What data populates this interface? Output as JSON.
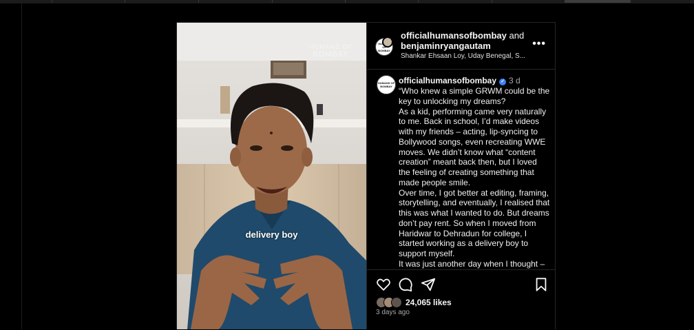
{
  "header": {
    "account_primary": "officialhumansofbombay",
    "joiner": "and",
    "account_collab": "benjaminryangautam",
    "audio_subtitle": "Shankar Ehsaan Loy, Uday Benegal, S...",
    "more_glyph": "•••"
  },
  "media": {
    "overlay_brand_line1": "HUMANS OF",
    "overlay_brand_line2": "BOMBAY",
    "subtitle_text": "delivery boy"
  },
  "caption": {
    "username": "officialhumansofbombay",
    "verified_glyph": "✓",
    "time_ago": "3 d",
    "paragraphs": [
      "“Who knew a simple GRWM could be the key to unlocking my dreams?",
      "As a kid, performing came very naturally to me. Back in school, I’d make videos with my friends – acting, lip-syncing to Bollywood songs, even recreating WWE moves. We didn’t know what “content creation” meant back then, but I loved the feeling of creating something that made people smile.",
      "Over time, I got better at editing, framing, storytelling, and eventually, I realised that this was what I wanted to do. But dreams don’t pay rent. So when I moved from Haridwar to Dehradun for college, I started working as a delivery boy to support myself.",
      "It was just another day when I thought –"
    ]
  },
  "avatar_text": "HUMANS OF BOMBAY",
  "footer": {
    "likes": "24,065 likes",
    "posted": "3 days ago"
  },
  "icons": {
    "like": "heart-icon",
    "comment": "comment-icon",
    "share": "share-icon",
    "save": "bookmark-icon"
  },
  "colors": {
    "background": "#000000",
    "verified": "#3b82f6",
    "muted_text": "#a8a8a8",
    "shirt": "#1f4a6b",
    "wall": "#d6d3cf"
  }
}
